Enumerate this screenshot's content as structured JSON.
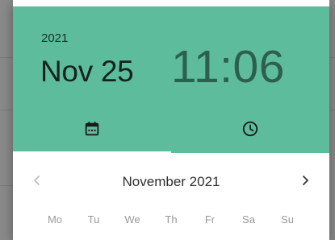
{
  "header": {
    "year": "2021",
    "date": "Nov 25",
    "time": "11:06",
    "background_color": "#5cbc9b"
  },
  "tabs": [
    {
      "name": "date",
      "icon": "calendar-icon",
      "selected": true
    },
    {
      "name": "time",
      "icon": "clock-icon",
      "selected": false
    }
  ],
  "calendar": {
    "month_label": "November 2021",
    "prev_icon": "chevron-left-icon",
    "next_icon": "chevron-right-icon",
    "weekdays": [
      "Mo",
      "Tu",
      "We",
      "Th",
      "Fr",
      "Sa",
      "Su"
    ]
  }
}
